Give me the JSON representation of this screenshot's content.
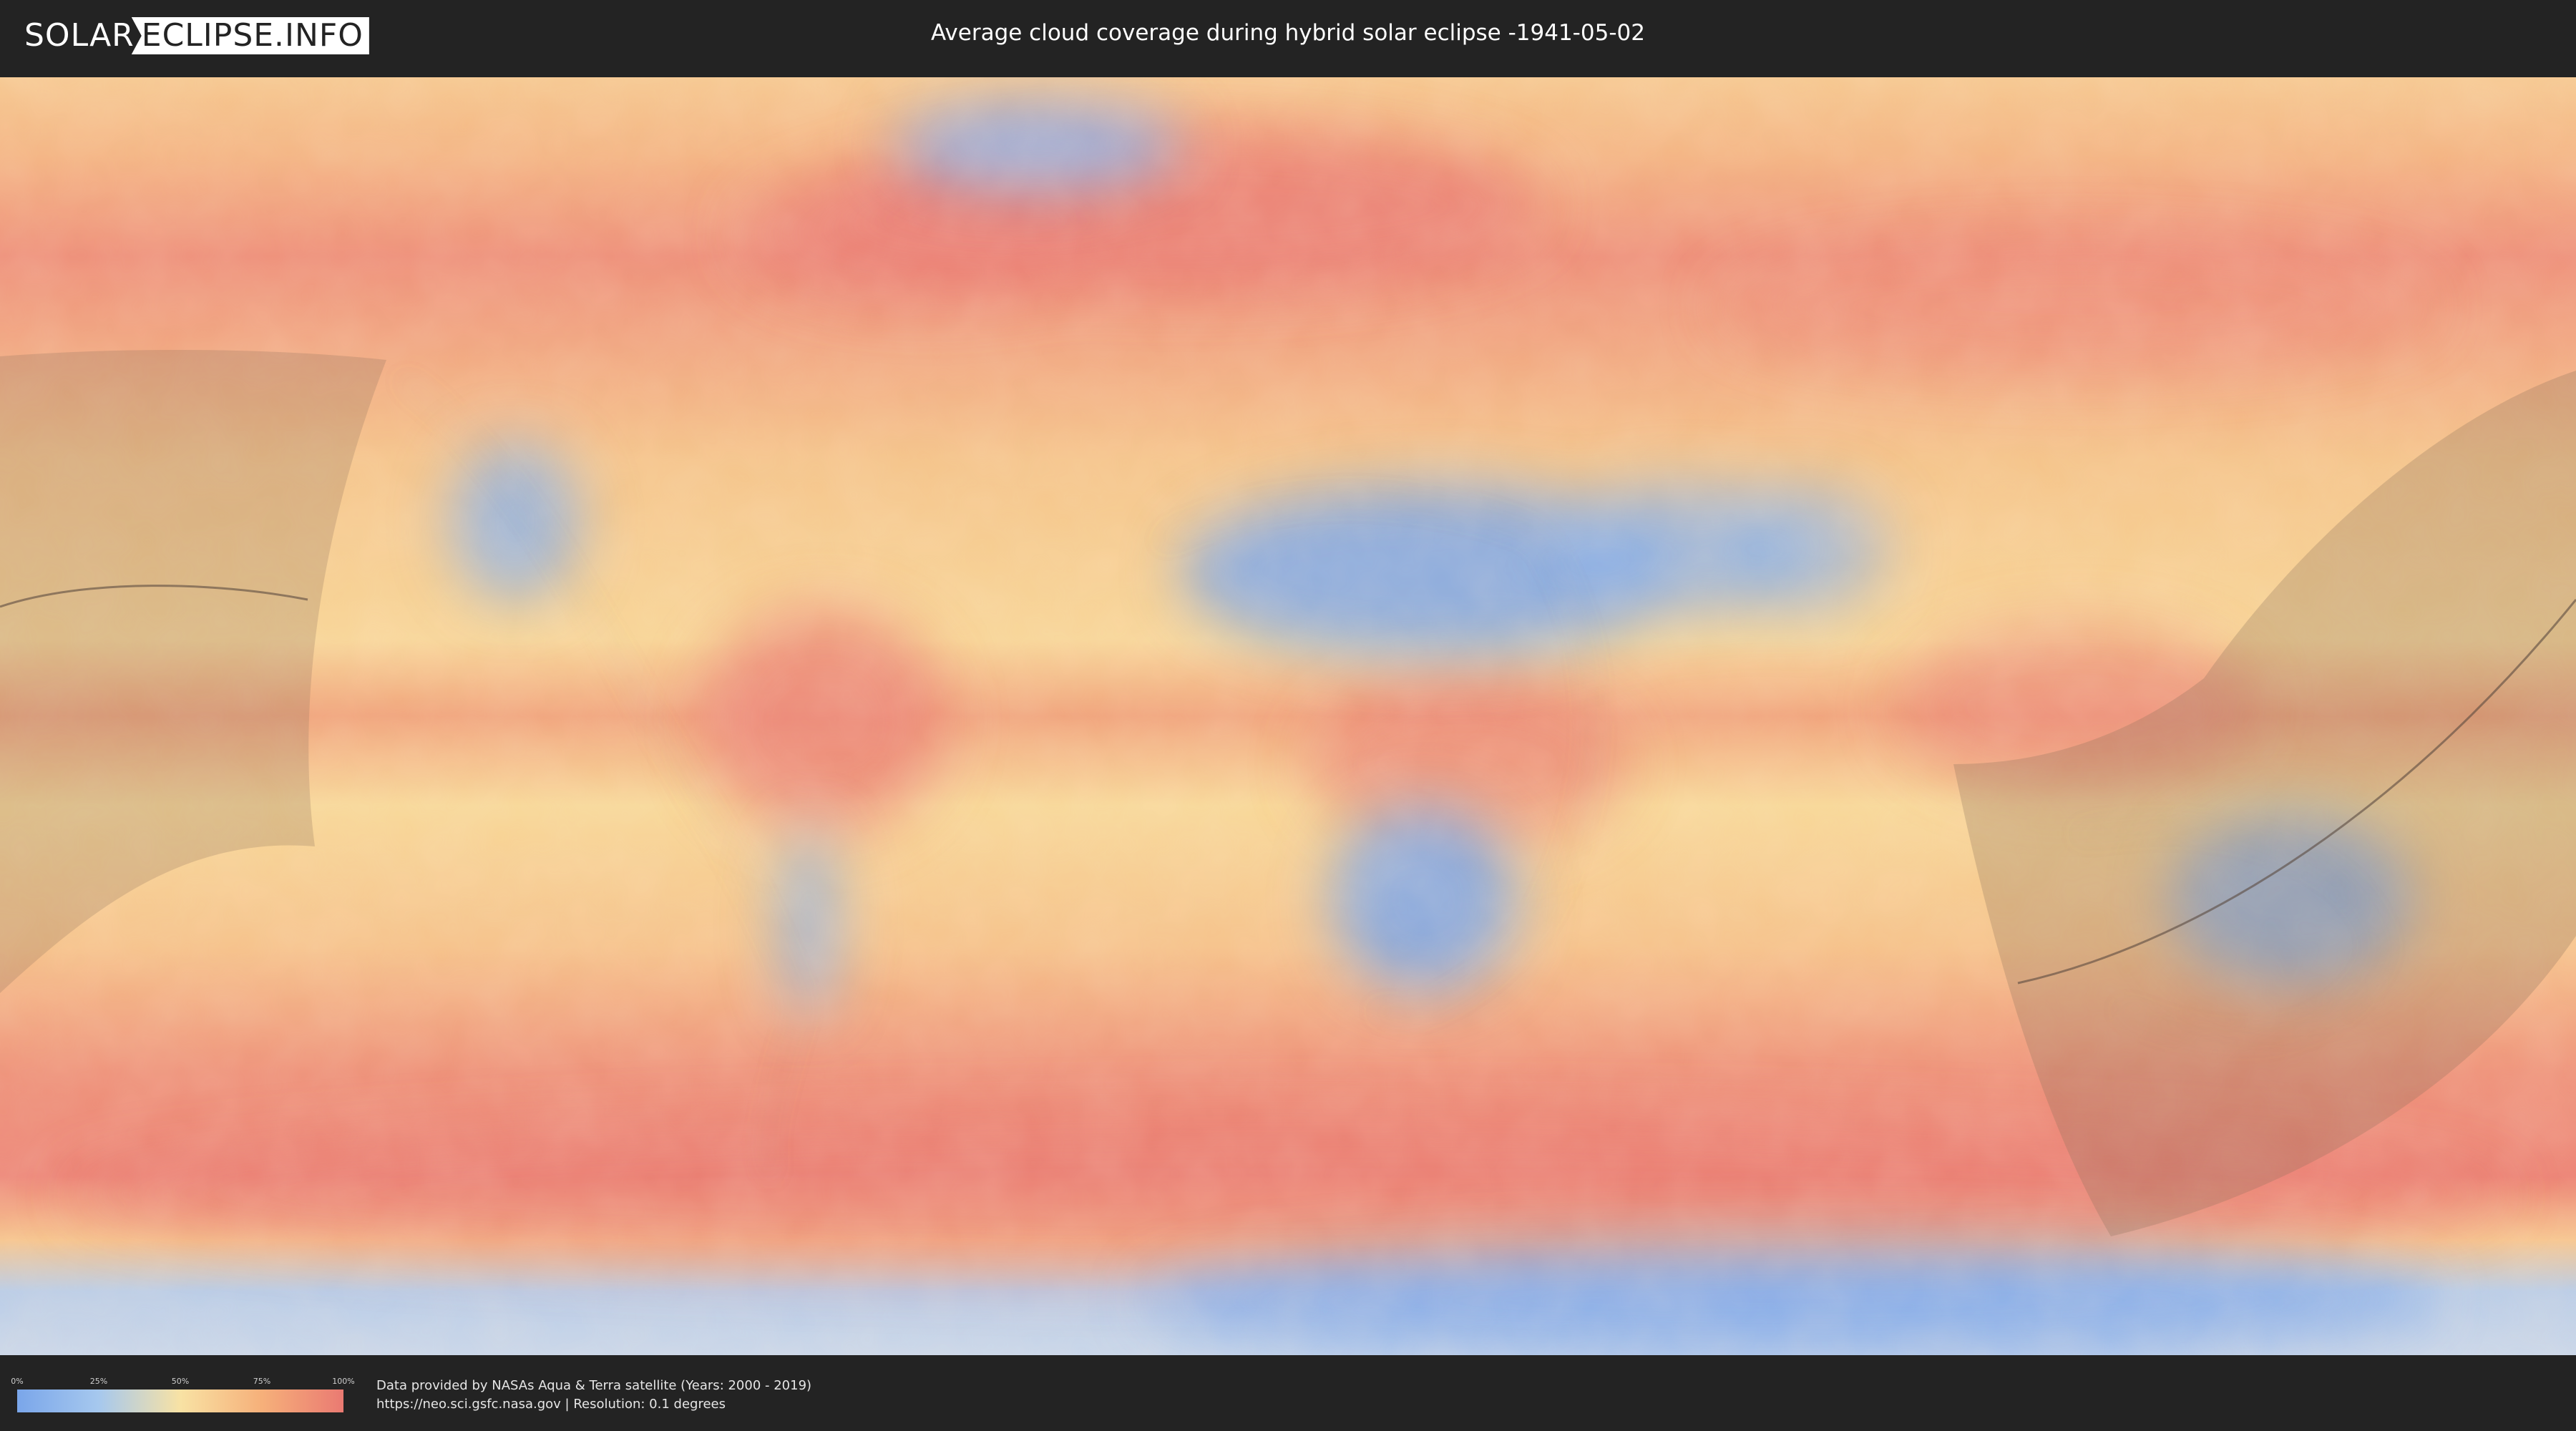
{
  "header": {
    "logo_left": "SOLAR",
    "logo_right": "ECLIPSE.INFO",
    "title": "Average cloud coverage during hybrid solar eclipse -1941-05-02"
  },
  "legend": {
    "ticks": [
      "0%",
      "25%",
      "50%",
      "75%",
      "100%"
    ]
  },
  "footer": {
    "credit_line1": "Data provided by NASAs Aqua & Terra satellite (Years: 2000 - 2019)",
    "credit_line2": "https://neo.sci.gsfc.nasa.gov | Resolution: 0.1 degrees"
  },
  "colors": {
    "low_cloud": "#7aa6ea",
    "mid_cloud": "#f8e2a4",
    "high_cloud": "#ea7a72",
    "background": "#232323"
  }
}
